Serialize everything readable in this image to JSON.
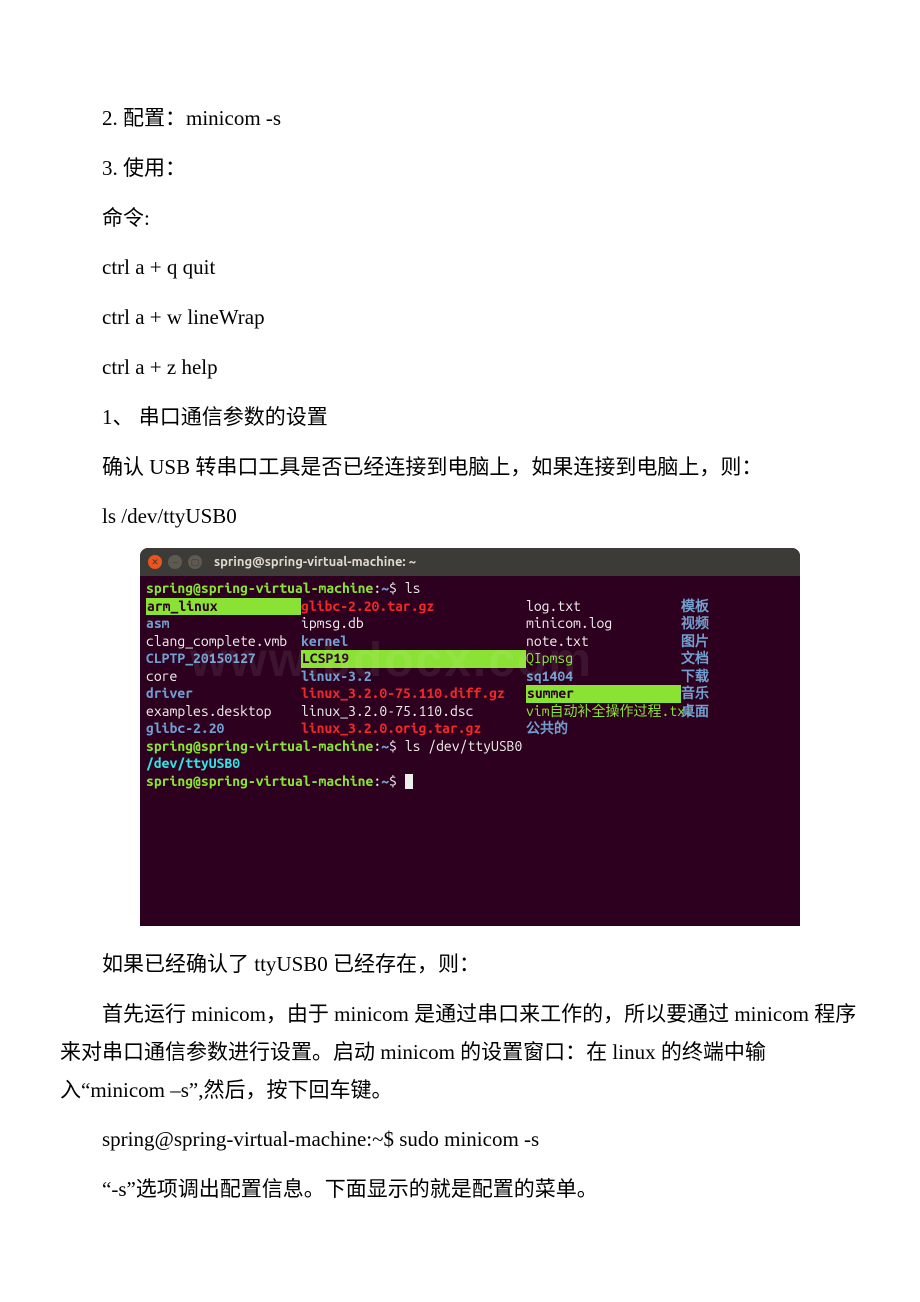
{
  "doc": {
    "p1": "2. 配置：minicom -s",
    "p2": "3. 使用：",
    "p3": "命令:",
    "p4": " ctrl a + q quit",
    "p5": "ctrl a + w lineWrap",
    "p6": "ctrl a + z help",
    "p7": "1、 串口通信参数的设置",
    "p8": "确认 USB 转串口工具是否已经连接到电脑上，如果连接到电脑上，则：",
    "p9": "ls /dev/ttyUSB0",
    "p10": "如果已经确认了 ttyUSB0 已经存在，则：",
    "p11": "首先运行 minicom，由于 minicom 是通过串口来工作的，所以要通过 minicom 程序来对串口通信参数进行设置。启动 minicom 的设置窗口：在 linux 的终端中输入“minicom –s”,然后，按下回车键。",
    "p12": "spring@spring-virtual-machine:~$ sudo minicom -s",
    "p13": "“-s”选项调出配置信息。下面显示的就是配置的菜单。"
  },
  "terminal": {
    "title": "spring@spring-virtual-machine: ~",
    "prompt_user": "spring@spring-virtual-machine",
    "prompt_path": "~",
    "cmd1": "ls",
    "cmd2": "ls /dev/ttyUSB0",
    "result2": "/dev/ttyUSB0",
    "ls": {
      "c1": [
        "arm_linux",
        "asm",
        "clang_complete.vmb",
        "CLPTP_20150127",
        "core",
        "driver",
        "examples.desktop",
        "glibc-2.20"
      ],
      "c2": [
        "glibc-2.20.tar.gz",
        "ipmsg.db",
        "kernel",
        "LCSP19",
        "linux-3.2",
        "linux_3.2.0-75.110.diff.gz",
        "linux_3.2.0-75.110.dsc",
        "linux_3.2.0.orig.tar.gz"
      ],
      "c3": [
        "log.txt",
        "minicom.log",
        "note.txt",
        "QIpmsg",
        "sq1404",
        "summer",
        "vim自动补全操作过程.txt",
        "公共的"
      ],
      "c4": [
        "模板",
        "视频",
        "图片",
        "文档",
        "下载",
        "音乐",
        "桌面",
        ""
      ]
    },
    "watermark": "www.bdocx.com"
  }
}
